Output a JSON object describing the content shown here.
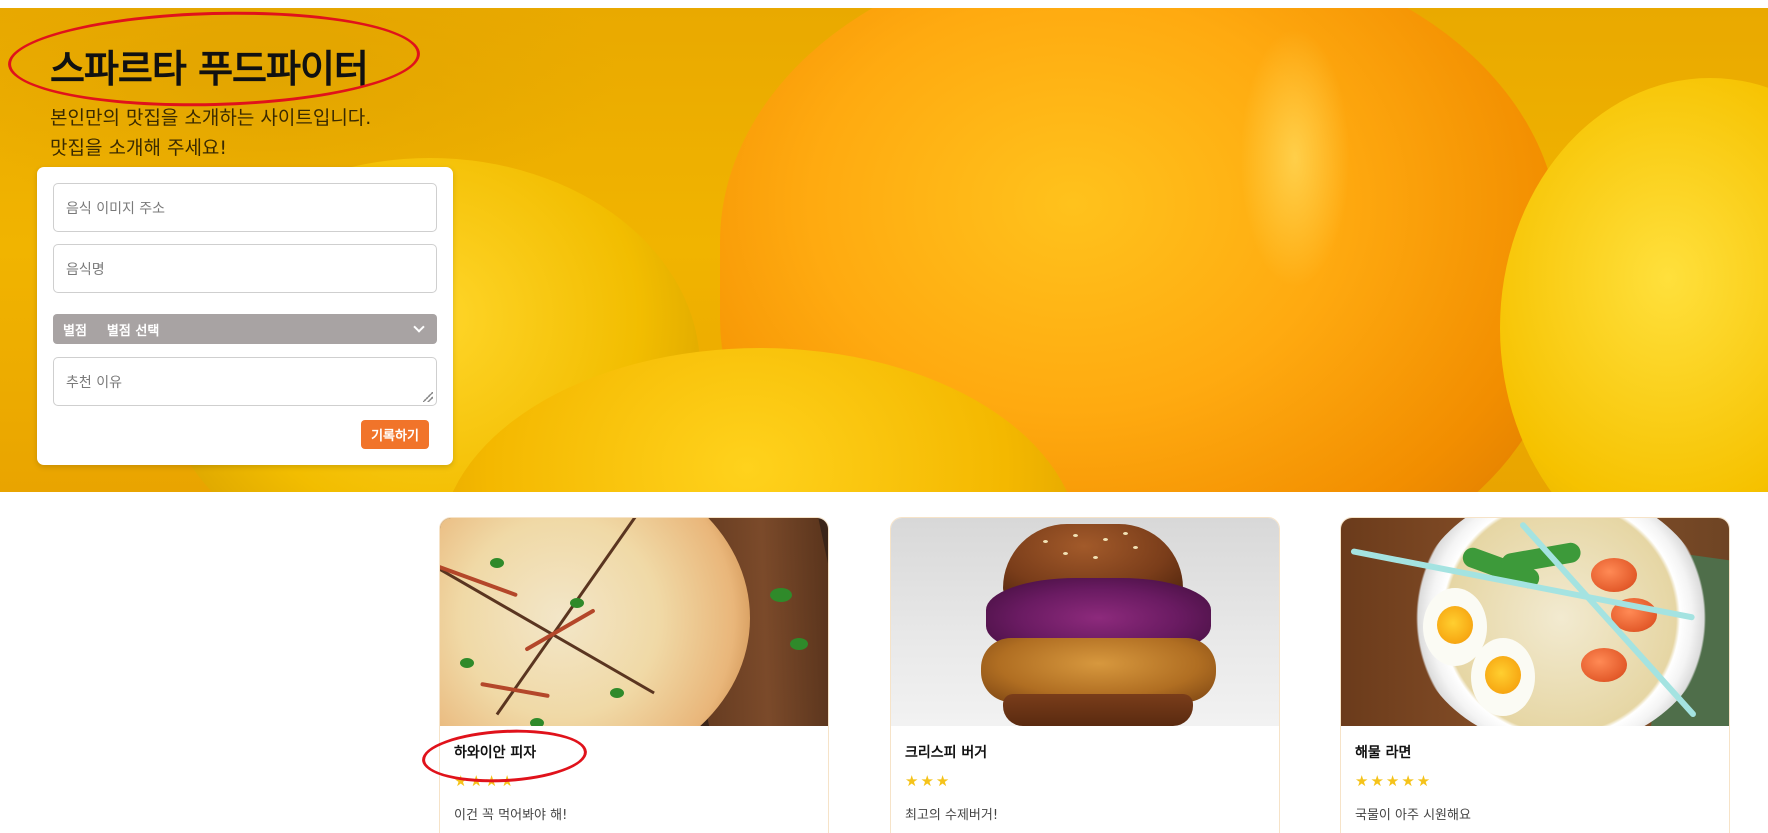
{
  "hero": {
    "title": "스파르타 푸드파이터",
    "description_line1": "본인만의 맛집을 소개하는 사이트입니다.",
    "description_line2": "맛집을 소개해 주세요!"
  },
  "form": {
    "image_url_placeholder": "음식 이미지 주소",
    "food_name_placeholder": "음식명",
    "rating_label": "별점",
    "rating_selected": "별점 선택",
    "reason_placeholder": "추천 이유",
    "submit_label": "기록하기"
  },
  "cards": [
    {
      "title": "하와이안 피자",
      "stars": "★★★★",
      "rating": 4,
      "comment": "이건 꼭 먹어봐야 해!"
    },
    {
      "title": "크리스피 버거",
      "stars": "★★★",
      "rating": 3,
      "comment": "최고의 수제버거!"
    },
    {
      "title": "해물 라면",
      "stars": "★★★★★",
      "rating": 5,
      "comment": "국물이 아주 시원해요"
    }
  ],
  "colors": {
    "accent": "#f1742a",
    "star": "#f5c31a",
    "annotation": "#e0121b",
    "select_bg": "#a8a3a3"
  },
  "icons": {
    "select_arrow": "chevron-down-icon",
    "textarea_resize": "resize-grip-icon"
  }
}
